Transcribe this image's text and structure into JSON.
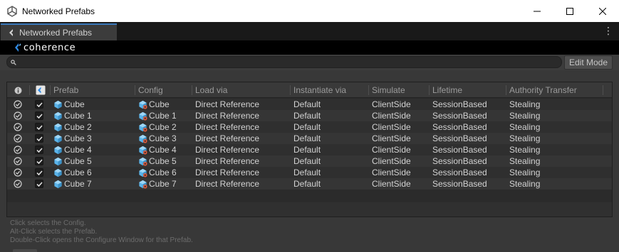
{
  "window": {
    "title": "Networked Prefabs"
  },
  "tab": {
    "label": "Networked Prefabs"
  },
  "brand": {
    "name": "coherence"
  },
  "toolbar": {
    "search_value": "",
    "edit_mode_label": "Edit Mode"
  },
  "table": {
    "columns": [
      "Prefab",
      "Config",
      "Load via",
      "Instantiate via",
      "Simulate",
      "Lifetime",
      "Authority Transfer"
    ],
    "rows": [
      {
        "prefab": "Cube",
        "config": "Cube",
        "load_via": "Direct Reference",
        "instantiate_via": "Default",
        "simulate": "ClientSide",
        "lifetime": "SessionBased",
        "authority": "Stealing",
        "checked": true
      },
      {
        "prefab": "Cube 1",
        "config": "Cube 1",
        "load_via": "Direct Reference",
        "instantiate_via": "Default",
        "simulate": "ClientSide",
        "lifetime": "SessionBased",
        "authority": "Stealing",
        "checked": true
      },
      {
        "prefab": "Cube 2",
        "config": "Cube 2",
        "load_via": "Direct Reference",
        "instantiate_via": "Default",
        "simulate": "ClientSide",
        "lifetime": "SessionBased",
        "authority": "Stealing",
        "checked": true
      },
      {
        "prefab": "Cube 3",
        "config": "Cube 3",
        "load_via": "Direct Reference",
        "instantiate_via": "Default",
        "simulate": "ClientSide",
        "lifetime": "SessionBased",
        "authority": "Stealing",
        "checked": true
      },
      {
        "prefab": "Cube 4",
        "config": "Cube 4",
        "load_via": "Direct Reference",
        "instantiate_via": "Default",
        "simulate": "ClientSide",
        "lifetime": "SessionBased",
        "authority": "Stealing",
        "checked": true
      },
      {
        "prefab": "Cube 5",
        "config": "Cube 5",
        "load_via": "Direct Reference",
        "instantiate_via": "Default",
        "simulate": "ClientSide",
        "lifetime": "SessionBased",
        "authority": "Stealing",
        "checked": true
      },
      {
        "prefab": "Cube 6",
        "config": "Cube 6",
        "load_via": "Direct Reference",
        "instantiate_via": "Default",
        "simulate": "ClientSide",
        "lifetime": "SessionBased",
        "authority": "Stealing",
        "checked": true
      },
      {
        "prefab": "Cube 7",
        "config": "Cube 7",
        "load_via": "Direct Reference",
        "instantiate_via": "Default",
        "simulate": "ClientSide",
        "lifetime": "SessionBased",
        "authority": "Stealing",
        "checked": true
      }
    ]
  },
  "hints": [
    "Click selects the Config.",
    "Alt-Click selects the Prefab.",
    "Double-Click opens the Configure Window for that Prefab."
  ],
  "colors": {
    "accent": "#3a79bb",
    "cube": "#5bb4ea",
    "config_badge": "#e05a3c"
  }
}
